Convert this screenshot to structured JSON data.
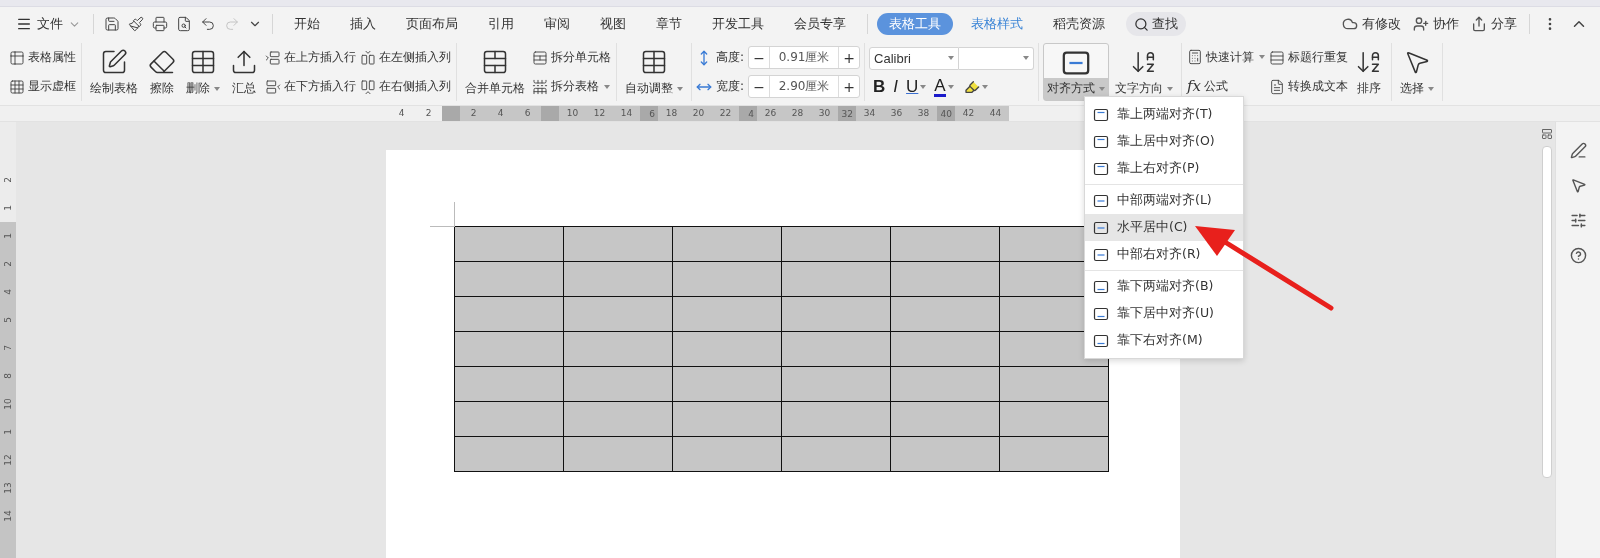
{
  "menu": {
    "file_label": "文件",
    "tabs": [
      {
        "label": "开始",
        "selected": false,
        "contextual": false
      },
      {
        "label": "插入",
        "selected": false,
        "contextual": false
      },
      {
        "label": "页面布局",
        "selected": false,
        "contextual": false
      },
      {
        "label": "引用",
        "selected": false,
        "contextual": false
      },
      {
        "label": "审阅",
        "selected": false,
        "contextual": false
      },
      {
        "label": "视图",
        "selected": false,
        "contextual": false
      },
      {
        "label": "章节",
        "selected": false,
        "contextual": false
      },
      {
        "label": "开发工具",
        "selected": false,
        "contextual": false
      },
      {
        "label": "会员专享",
        "selected": false,
        "contextual": false
      },
      {
        "label": "表格工具",
        "selected": true,
        "contextual": true
      },
      {
        "label": "表格样式",
        "selected": false,
        "contextual": true
      },
      {
        "label": "稻壳资源",
        "selected": false,
        "contextual": false
      }
    ],
    "search_label": "查找",
    "status_label": "有修改",
    "actions": [
      {
        "label": "协作"
      },
      {
        "label": "分享"
      }
    ]
  },
  "ribbon": {
    "groups": [
      {
        "items": [
          {
            "kind": "stack",
            "buttons": [
              {
                "label": "表格属性",
                "dropdown": false
              },
              {
                "label": "显示虚框",
                "dropdown": false
              }
            ]
          }
        ]
      },
      {
        "items": [
          {
            "kind": "large",
            "label": "绘制表格",
            "dropdown": false,
            "pressed": false
          },
          {
            "kind": "large",
            "label": "擦除",
            "dropdown": false,
            "pressed": false
          },
          {
            "kind": "large",
            "label": "删除",
            "dropdown": true,
            "pressed": false
          },
          {
            "kind": "large",
            "label": "汇总",
            "dropdown": false,
            "pressed": false
          },
          {
            "kind": "stack",
            "buttons": [
              {
                "label": "在上方插入行",
                "dropdown": false
              },
              {
                "label": "在下方插入行",
                "dropdown": false
              }
            ]
          },
          {
            "kind": "stack",
            "buttons": [
              {
                "label": "在左侧插入列",
                "dropdown": false
              },
              {
                "label": "在右侧插入列",
                "dropdown": false
              }
            ]
          }
        ]
      },
      {
        "items": [
          {
            "kind": "large",
            "label": "合并单元格",
            "dropdown": false,
            "pressed": false
          },
          {
            "kind": "stack",
            "buttons": [
              {
                "label": "拆分单元格",
                "dropdown": false
              },
              {
                "label": "拆分表格",
                "dropdown": true
              }
            ]
          }
        ]
      },
      {
        "items": [
          {
            "kind": "large",
            "label": "自动调整",
            "dropdown": true,
            "pressed": false
          }
        ]
      },
      {
        "items": [
          {
            "kind": "size",
            "fields": [
              {
                "label": "高度:",
                "value": "0.91厘米",
                "minus": "−",
                "plus": "+"
              },
              {
                "label": "宽度:",
                "value": "2.90厘米",
                "minus": "−",
                "plus": "+"
              }
            ]
          }
        ]
      },
      {
        "items": [
          {
            "kind": "font",
            "font_name": "Calibri",
            "bold": "B",
            "italic": "I",
            "underline": "U",
            "color_letter": "A"
          }
        ]
      },
      {
        "items": [
          {
            "kind": "large",
            "label": "对齐方式",
            "dropdown": true,
            "pressed": true
          },
          {
            "kind": "large",
            "label": "文字方向",
            "dropdown": true,
            "pressed": false
          }
        ]
      },
      {
        "items": [
          {
            "kind": "stack",
            "buttons": [
              {
                "label": "快速计算",
                "dropdown": true
              },
              {
                "label": "公式",
                "dropdown": false,
                "glyph": "fx"
              }
            ]
          },
          {
            "kind": "stack",
            "buttons": [
              {
                "label": "标题行重复",
                "dropdown": false
              },
              {
                "label": "转换成文本",
                "dropdown": false
              }
            ]
          },
          {
            "kind": "large",
            "label": "排序",
            "dropdown": false,
            "pressed": false
          }
        ]
      },
      {
        "items": [
          {
            "kind": "large",
            "label": "选择",
            "dropdown": true,
            "pressed": false
          }
        ]
      }
    ]
  },
  "ruler": {
    "marks": [
      {
        "kind": "number",
        "label": "4"
      },
      {
        "kind": "number",
        "label": "2"
      },
      {
        "kind": "marker"
      },
      {
        "kind": "number",
        "label": "2"
      },
      {
        "kind": "number",
        "label": "4"
      },
      {
        "kind": "number",
        "label": "6"
      },
      {
        "kind": "marker"
      },
      {
        "kind": "number",
        "label": "10"
      },
      {
        "kind": "number",
        "label": "12"
      },
      {
        "kind": "number",
        "label": "14"
      },
      {
        "kind": "marker",
        "label": "6"
      },
      {
        "kind": "number",
        "label": "18"
      },
      {
        "kind": "number",
        "label": "20"
      },
      {
        "kind": "number",
        "label": "22"
      },
      {
        "kind": "marker",
        "label": "4"
      },
      {
        "kind": "number",
        "label": "26"
      },
      {
        "kind": "number",
        "label": "28"
      },
      {
        "kind": "number",
        "label": "30"
      },
      {
        "kind": "marker",
        "label": "32"
      },
      {
        "kind": "number",
        "label": "34"
      },
      {
        "kind": "number",
        "label": "36"
      },
      {
        "kind": "number",
        "label": "38"
      },
      {
        "kind": "marker",
        "label": "40"
      },
      {
        "kind": "number",
        "label": "42"
      },
      {
        "kind": "number",
        "label": "44"
      }
    ]
  },
  "vertical_ruler": {
    "labels": [
      "2",
      "1",
      "1",
      "2",
      "4",
      "5",
      "7",
      "8",
      "10",
      "1",
      "12",
      "13",
      "14"
    ]
  },
  "table": {
    "rows": [
      {
        "cells": [
          {
            "selected": true
          },
          {
            "selected": true
          },
          {
            "selected": true
          },
          {
            "selected": true
          },
          {
            "selected": true
          },
          {
            "selected": true
          }
        ]
      },
      {
        "cells": [
          {
            "selected": true
          },
          {
            "selected": true
          },
          {
            "selected": true
          },
          {
            "selected": true
          },
          {
            "selected": true
          },
          {
            "selected": true
          }
        ]
      },
      {
        "cells": [
          {
            "selected": true
          },
          {
            "selected": true
          },
          {
            "selected": true
          },
          {
            "selected": true
          },
          {
            "selected": true
          },
          {
            "selected": true
          }
        ]
      },
      {
        "cells": [
          {
            "selected": true
          },
          {
            "selected": true
          },
          {
            "selected": true
          },
          {
            "selected": true
          },
          {
            "selected": true
          },
          {
            "selected": true
          }
        ]
      },
      {
        "cells": [
          {
            "selected": true
          },
          {
            "selected": true
          },
          {
            "selected": true
          },
          {
            "selected": true
          },
          {
            "selected": true
          },
          {
            "selected": true
          }
        ]
      },
      {
        "cells": [
          {
            "selected": true
          },
          {
            "selected": true
          },
          {
            "selected": true
          },
          {
            "selected": true
          },
          {
            "selected": true
          },
          {
            "selected": true
          }
        ]
      },
      {
        "cells": [
          {
            "selected": true
          },
          {
            "selected": true
          },
          {
            "selected": true
          },
          {
            "selected": true
          },
          {
            "selected": true
          },
          {
            "selected": true
          }
        ]
      }
    ]
  },
  "align_menu": {
    "groups": [
      [
        {
          "label": "靠上两端对齐(T)",
          "selected": false
        },
        {
          "label": "靠上居中对齐(O)",
          "selected": false
        },
        {
          "label": "靠上右对齐(P)",
          "selected": false
        }
      ],
      [
        {
          "label": "中部两端对齐(L)",
          "selected": false
        },
        {
          "label": "水平居中(C)",
          "selected": true
        },
        {
          "label": "中部右对齐(R)",
          "selected": false
        }
      ],
      [
        {
          "label": "靠下两端对齐(B)",
          "selected": false
        },
        {
          "label": "靠下居中对齐(U)",
          "selected": false
        },
        {
          "label": "靠下右对齐(M)",
          "selected": false
        }
      ]
    ]
  }
}
